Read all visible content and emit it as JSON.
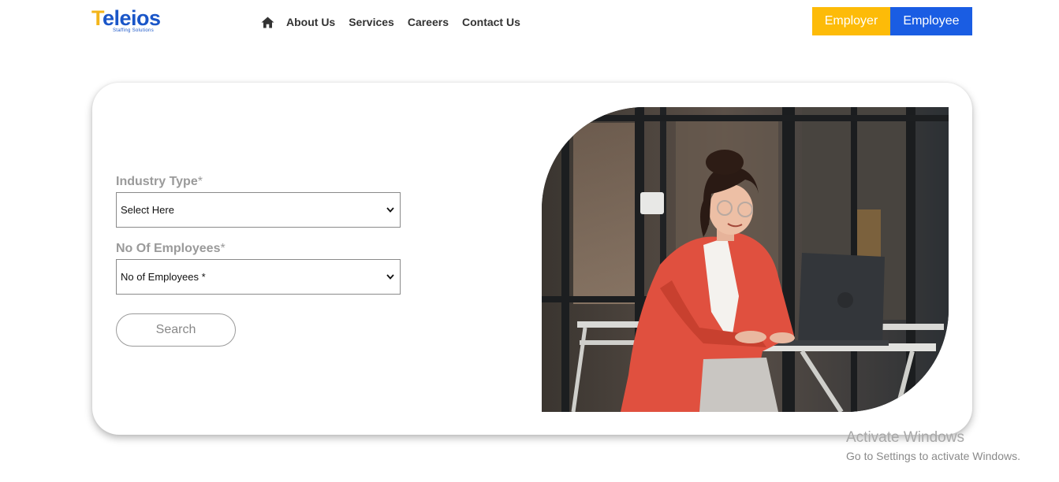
{
  "header": {
    "logo_text": "Teleios",
    "logo_tagline": "Staffing Solutions",
    "nav": {
      "home_icon": "home-icon",
      "items": [
        "About Us",
        "Services",
        "Careers",
        "Contact Us"
      ]
    },
    "employer_button": "Employer",
    "employee_button": "Employee"
  },
  "form": {
    "industry_label": "Industry Type",
    "industry_required": "*",
    "industry_value": "Select Here",
    "employees_label": "No Of Employees",
    "employees_required": "*",
    "employees_value": "No of Employees *",
    "search_button": "Search"
  },
  "watermark": {
    "title": "Activate Windows",
    "subtitle": "Go to Settings to activate Windows."
  },
  "colors": {
    "employer_accent": "#fdbb08",
    "employee_accent": "#1a5de3",
    "brand_blue": "#1a56c8",
    "brand_yellow": "#f3b51a"
  }
}
